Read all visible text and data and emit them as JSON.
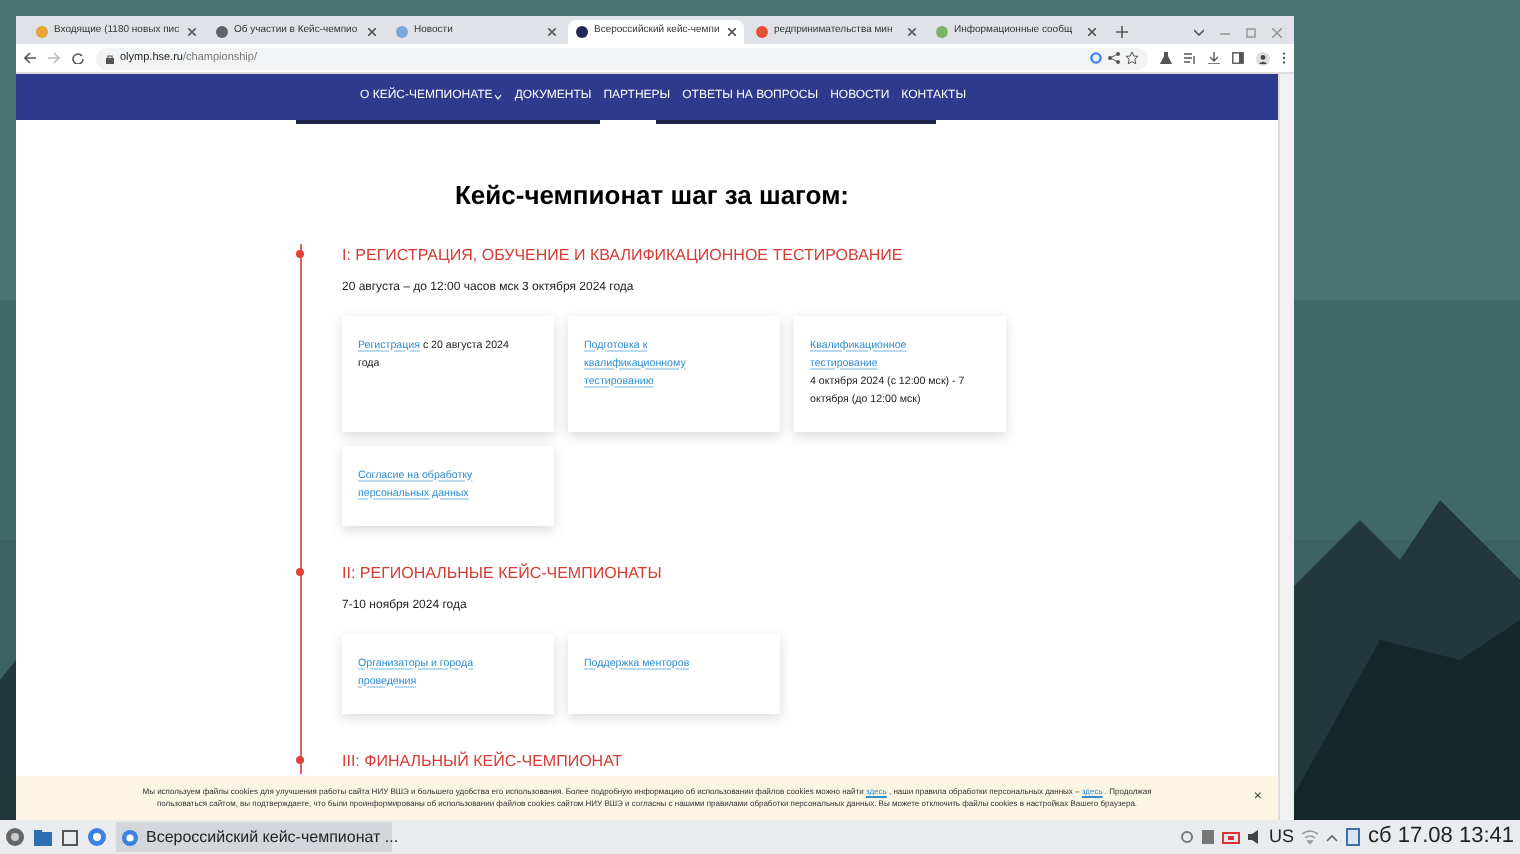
{
  "browser": {
    "tabs": [
      {
        "label": "Входящие (1180 новых пис",
        "selected": false,
        "color": "#e8a33d"
      },
      {
        "label": "Об участии в Кейс-чемпио",
        "selected": false,
        "color": "#5f6368"
      },
      {
        "label": "Новости",
        "selected": false,
        "color": "#7aa7d8"
      },
      {
        "label": "Всероссийский кейс-чемпи",
        "selected": true,
        "color": "#1f2a5c"
      },
      {
        "label": "редпринимательства мин",
        "selected": false,
        "color": "#e8503a"
      },
      {
        "label": "Информационные сообщ",
        "selected": false,
        "color": "#7fb069"
      }
    ],
    "url_host": "olymp.hse.ru",
    "url_path": "/championship/"
  },
  "site_nav": [
    {
      "label": "О КЕЙС-ЧЕМПИОНАТЕ",
      "dropdown": true
    },
    {
      "label": "ДОКУМЕНТЫ",
      "dropdown": false
    },
    {
      "label": "ПАРТНЕРЫ",
      "dropdown": false
    },
    {
      "label": "ОТВЕТЫ НА ВОПРОСЫ",
      "dropdown": false
    },
    {
      "label": "НОВОСТИ",
      "dropdown": false
    },
    {
      "label": "КОНТАКТЫ",
      "dropdown": false
    }
  ],
  "heading": "Кейс-чемпионат шаг за шагом:",
  "steps": [
    {
      "title": "I: РЕГИСТРАЦИЯ, ОБУЧЕНИЕ И КВАЛИФИКАЦИОННОЕ ТЕСТИРОВАНИЕ",
      "date": "20 августа – до 12:00 часов мск 3 октября 2024 года",
      "cards": [
        {
          "link": "Регистрация",
          "text": "с 20 августа 2024 года",
          "kind": "inline"
        },
        {
          "link": "Подготовка к квалификационному тестированию"
        },
        {
          "link": "Квалификационное тестирование",
          "text": "4 октября 2024 (с 12:00 мск) - 7 октября (до 12:00 мск)",
          "kind": "block"
        },
        {
          "link": "Согласие на обработку персональных данных"
        }
      ]
    },
    {
      "title": "II: РЕГИОНАЛЬНЫЕ КЕЙС-ЧЕМПИОНАТЫ",
      "date": "7-10 ноября 2024 года",
      "cards": [
        {
          "link": "Организаторы и города проведения"
        },
        {
          "link": "Поддержка менторов"
        }
      ]
    },
    {
      "title": "III: ФИНАЛЬНЫЙ КЕЙС-ЧЕМПИОНАТ"
    }
  ],
  "cookie_notice": {
    "lines": [
      [
        {
          "kind": "text",
          "text": "Мы используем файлы cookies для улучшения работы сайта НИУ ВШЭ и большего удобства его использования. Более подробную информацию об использовании файлов cookies можно найти"
        },
        {
          "kind": "link",
          "text": "здесь"
        },
        {
          "kind": "text",
          "text": ", наши правила обработки персональных данных –"
        },
        {
          "kind": "link",
          "text": "здесь"
        },
        {
          "kind": "text",
          "text": ". Продолжая"
        }
      ],
      [
        {
          "kind": "text",
          "text": "пользоваться сайтом, вы подтверждаете, что были проинформированы об использовании файлов cookies сайтом НИУ ВШЭ и согласны с нашими правилами обработки персональных данных. Вы можете отключить файлы cookies в настройках Вашего браузера."
        }
      ]
    ],
    "close": "×"
  },
  "taskbar": {
    "task": "Всероссийский кейс-чемпионат ...",
    "layout": "US",
    "clock": "сб 17.08 13:41"
  }
}
